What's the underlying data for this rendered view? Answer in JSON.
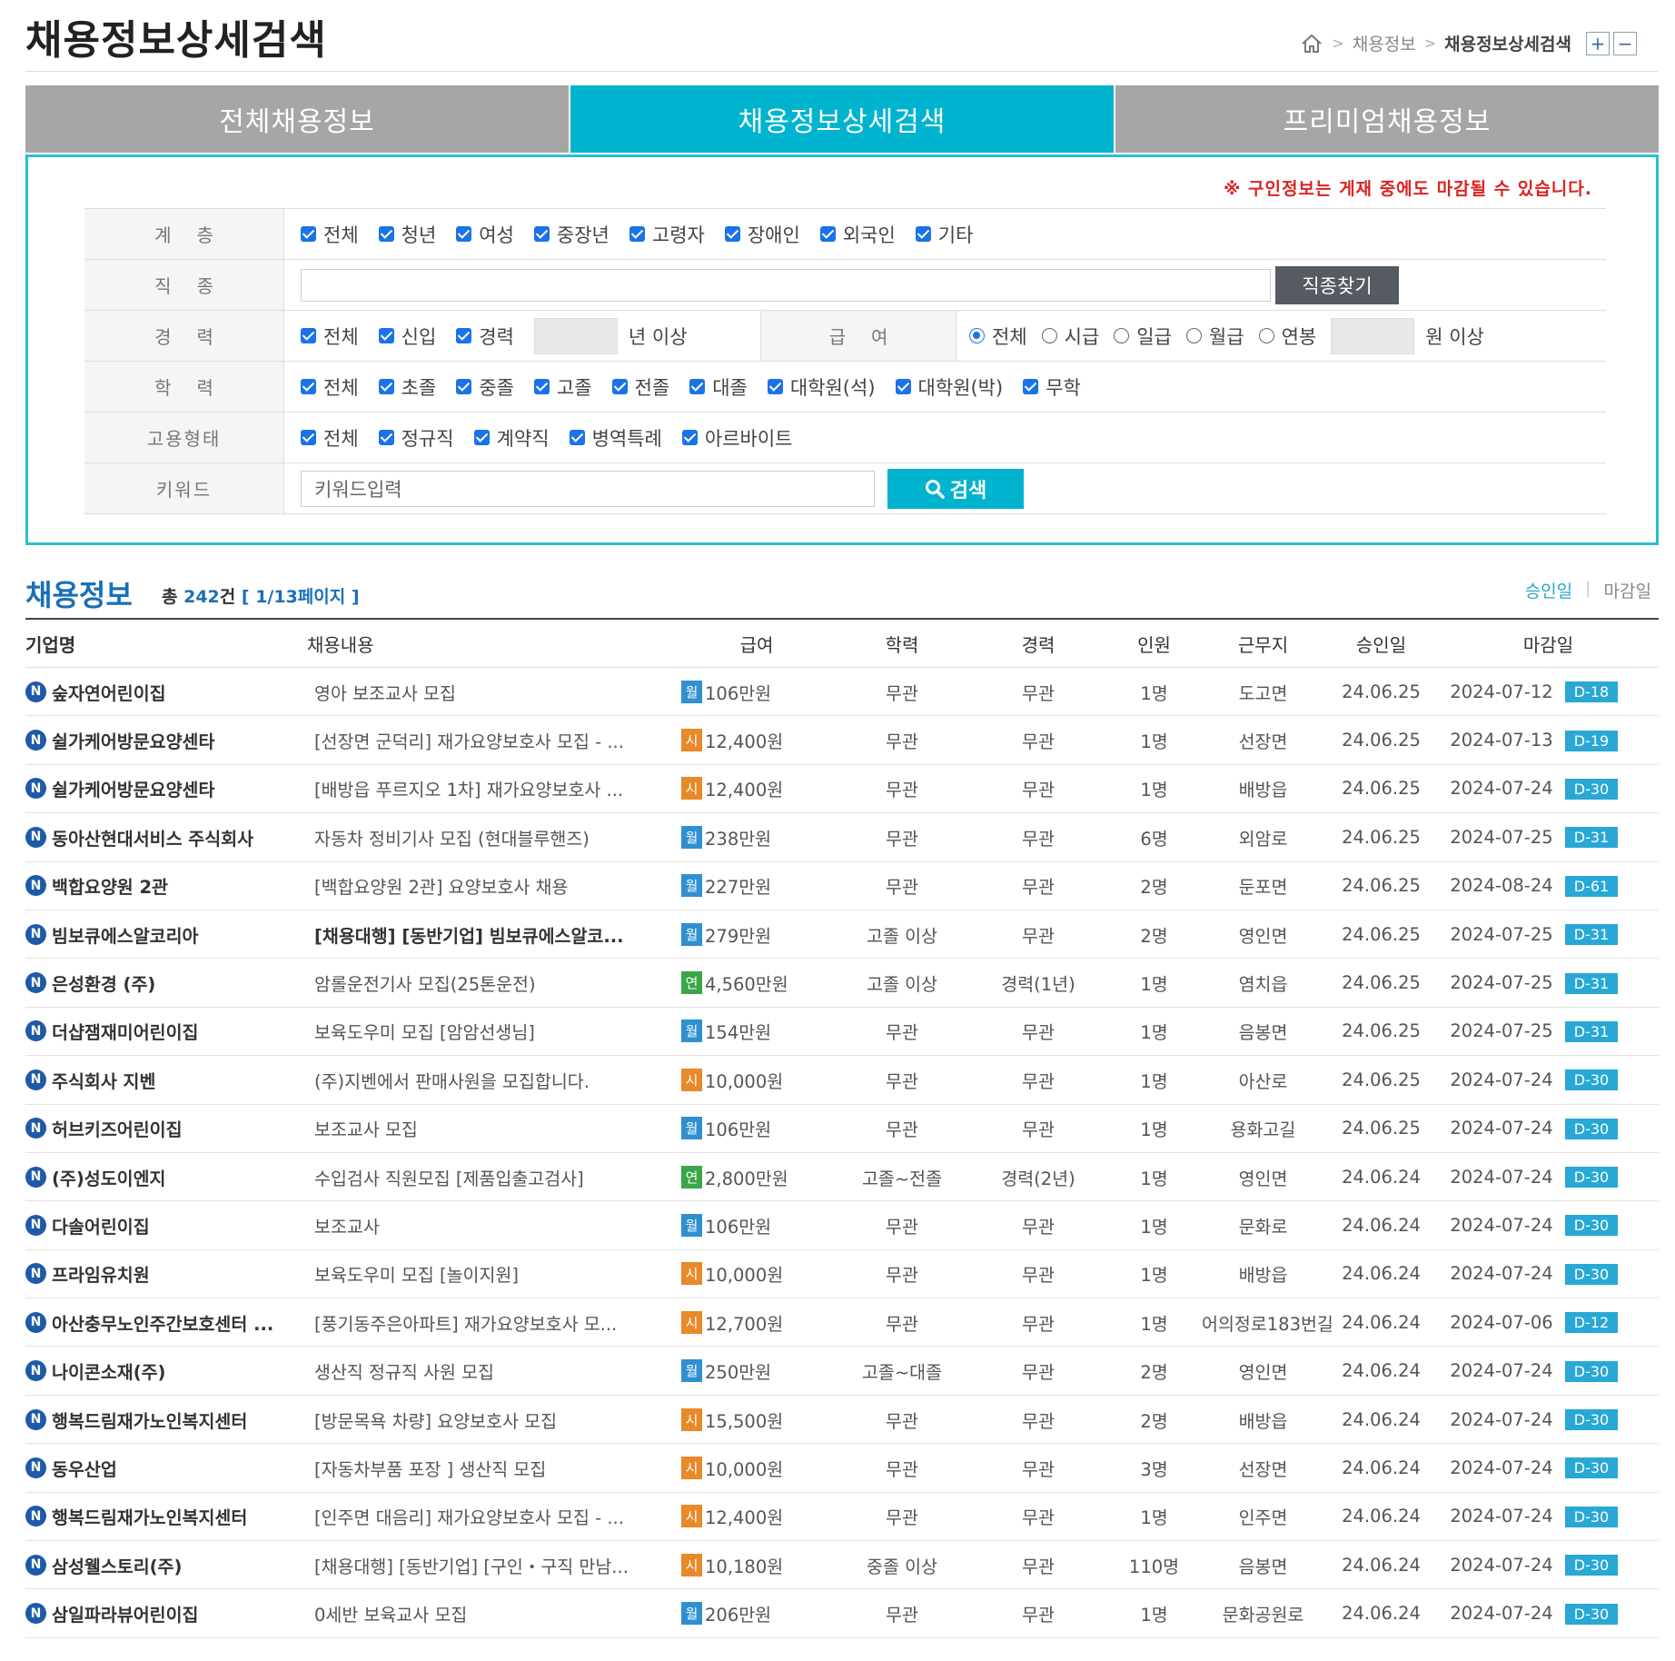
{
  "header": {
    "title": "채용정보상세검색",
    "breadcrumb": [
      "채용정보",
      "채용정보상세검색"
    ],
    "zoom_in": "+",
    "zoom_out": "−"
  },
  "tabs": [
    {
      "label": "전체채용정보",
      "active": false
    },
    {
      "label": "채용정보상세검색",
      "active": true
    },
    {
      "label": "프리미엄채용정보",
      "active": false
    }
  ],
  "search": {
    "notice": "※ 구인정보는 게재 중에도 마감될 수 있습니다.",
    "tier": {
      "label": "계층",
      "options": [
        "전체",
        "청년",
        "여성",
        "중장년",
        "고령자",
        "장애인",
        "외국인",
        "기타"
      ]
    },
    "job": {
      "label": "직종",
      "value": "",
      "button": "직종찾기"
    },
    "career": {
      "label": "경력",
      "options": [
        "전체",
        "신입",
        "경력"
      ],
      "years_suffix": "년 이상"
    },
    "salary": {
      "label": "급여",
      "options": [
        "전체",
        "시급",
        "일급",
        "월급",
        "연봉"
      ],
      "selected": "전체",
      "suffix": "원 이상"
    },
    "education": {
      "label": "학력",
      "options": [
        "전체",
        "초졸",
        "중졸",
        "고졸",
        "전졸",
        "대졸",
        "대학원(석)",
        "대학원(박)",
        "무학"
      ]
    },
    "employment": {
      "label": "고용형태",
      "options": [
        "전체",
        "정규직",
        "계약직",
        "병역특례",
        "아르바이트"
      ]
    },
    "keyword": {
      "label": "키워드",
      "placeholder": "키워드입력",
      "button": "검색"
    }
  },
  "results": {
    "title": "채용정보",
    "total_prefix": "총",
    "total": "242",
    "total_suffix": "건",
    "page_info": "[ 1/13페이지 ]",
    "sort": [
      "승인일",
      "마감일"
    ],
    "columns": [
      "기업명",
      "채용내용",
      "급여",
      "학력",
      "경력",
      "인원",
      "근무지",
      "승인일",
      "마감일"
    ]
  },
  "colors": {
    "accent": "#00b4cf",
    "monthly": "#2f8fd1",
    "hourly": "#e8892a",
    "annual": "#3aa64a",
    "dday": "#29a8d6"
  },
  "jobs": [
    {
      "company": "숲자연어린이집",
      "content": "영아 보조교사 모집",
      "pay_type": "월",
      "pay_color": "#2f8fd1",
      "pay": "106만원",
      "edu": "무관",
      "exp": "무관",
      "count": "1명",
      "loc": "도고면",
      "reg": "24.06.25",
      "deadline": "2024-07-12",
      "dday": "D-18"
    },
    {
      "company": "쉴가케어방문요양센타",
      "content": "[선장면 군덕리] 재가요양보호사 모집 - ...",
      "pay_type": "시",
      "pay_color": "#e8892a",
      "pay": "12,400원",
      "edu": "무관",
      "exp": "무관",
      "count": "1명",
      "loc": "선장면",
      "reg": "24.06.25",
      "deadline": "2024-07-13",
      "dday": "D-19"
    },
    {
      "company": "쉴가케어방문요양센타",
      "content": "[배방읍 푸르지오 1차] 재가요양보호사 ...",
      "pay_type": "시",
      "pay_color": "#e8892a",
      "pay": "12,400원",
      "edu": "무관",
      "exp": "무관",
      "count": "1명",
      "loc": "배방읍",
      "reg": "24.06.25",
      "deadline": "2024-07-24",
      "dday": "D-30"
    },
    {
      "company": "동아산현대서비스 주식회사",
      "content": "자동차 정비기사 모집 (현대블루핸즈)",
      "pay_type": "월",
      "pay_color": "#2f8fd1",
      "pay": "238만원",
      "edu": "무관",
      "exp": "무관",
      "count": "6명",
      "loc": "외암로",
      "reg": "24.06.25",
      "deadline": "2024-07-25",
      "dday": "D-31"
    },
    {
      "company": "백합요양원 2관",
      "content": "[백합요양원 2관] 요양보호사 채용",
      "pay_type": "월",
      "pay_color": "#2f8fd1",
      "pay": "227만원",
      "edu": "무관",
      "exp": "무관",
      "count": "2명",
      "loc": "둔포면",
      "reg": "24.06.25",
      "deadline": "2024-08-24",
      "dday": "D-61"
    },
    {
      "company": "빔보큐에스알코리아",
      "content": "[채용대행] [동반기업] 빔보큐에스알코...",
      "bold": true,
      "pay_type": "월",
      "pay_color": "#2f8fd1",
      "pay": "279만원",
      "edu": "고졸 이상",
      "exp": "무관",
      "count": "2명",
      "loc": "영인면",
      "reg": "24.06.25",
      "deadline": "2024-07-25",
      "dday": "D-31"
    },
    {
      "company": "은성환경 (주)",
      "content": "암롤운전기사 모집(25톤운전)",
      "pay_type": "연",
      "pay_color": "#3aa64a",
      "pay": "4,560만원",
      "edu": "고졸 이상",
      "exp": "경력(1년)",
      "count": "1명",
      "loc": "염치읍",
      "reg": "24.06.25",
      "deadline": "2024-07-25",
      "dday": "D-31"
    },
    {
      "company": "더샵잼재미어린이집",
      "content": "보육도우미 모집 [암암선생님]",
      "pay_type": "월",
      "pay_color": "#2f8fd1",
      "pay": "154만원",
      "edu": "무관",
      "exp": "무관",
      "count": "1명",
      "loc": "음봉면",
      "reg": "24.06.25",
      "deadline": "2024-07-25",
      "dday": "D-31"
    },
    {
      "company": "주식회사 지벤",
      "content": "(주)지벤에서 판매사원을 모집합니다.",
      "pay_type": "시",
      "pay_color": "#e8892a",
      "pay": "10,000원",
      "edu": "무관",
      "exp": "무관",
      "count": "1명",
      "loc": "아산로",
      "reg": "24.06.25",
      "deadline": "2024-07-24",
      "dday": "D-30"
    },
    {
      "company": "허브키즈어린이집",
      "content": "보조교사 모집",
      "pay_type": "월",
      "pay_color": "#2f8fd1",
      "pay": "106만원",
      "edu": "무관",
      "exp": "무관",
      "count": "1명",
      "loc": "용화고길",
      "reg": "24.06.25",
      "deadline": "2024-07-24",
      "dday": "D-30"
    },
    {
      "company": "(주)성도이엔지",
      "content": "수입검사 직원모집 [제품입출고검사]",
      "pay_type": "연",
      "pay_color": "#3aa64a",
      "pay": "2,800만원",
      "edu": "고졸~전졸",
      "exp": "경력(2년)",
      "count": "1명",
      "loc": "영인면",
      "reg": "24.06.24",
      "deadline": "2024-07-24",
      "dday": "D-30"
    },
    {
      "company": "다솔어린이집",
      "content": "보조교사",
      "pay_type": "월",
      "pay_color": "#2f8fd1",
      "pay": "106만원",
      "edu": "무관",
      "exp": "무관",
      "count": "1명",
      "loc": "문화로",
      "reg": "24.06.24",
      "deadline": "2024-07-24",
      "dday": "D-30"
    },
    {
      "company": "프라임유치원",
      "content": "보육도우미 모집 [놀이지원]",
      "pay_type": "시",
      "pay_color": "#e8892a",
      "pay": "10,000원",
      "edu": "무관",
      "exp": "무관",
      "count": "1명",
      "loc": "배방읍",
      "reg": "24.06.24",
      "deadline": "2024-07-24",
      "dday": "D-30"
    },
    {
      "company": "아산충무노인주간보호센터 ...",
      "content": "[풍기동주은아파트] 재가요양보호사 모...",
      "pay_type": "시",
      "pay_color": "#e8892a",
      "pay": "12,700원",
      "edu": "무관",
      "exp": "무관",
      "count": "1명",
      "loc": "어의정로183번길",
      "reg": "24.06.24",
      "deadline": "2024-07-06",
      "dday": "D-12"
    },
    {
      "company": "나이콘소재(주)",
      "content": "생산직 정규직 사원 모집",
      "pay_type": "월",
      "pay_color": "#2f8fd1",
      "pay": "250만원",
      "edu": "고졸~대졸",
      "exp": "무관",
      "count": "2명",
      "loc": "영인면",
      "reg": "24.06.24",
      "deadline": "2024-07-24",
      "dday": "D-30"
    },
    {
      "company": "행복드림재가노인복지센터",
      "content": "[방문목욕 차량] 요양보호사 모집",
      "pay_type": "시",
      "pay_color": "#e8892a",
      "pay": "15,500원",
      "edu": "무관",
      "exp": "무관",
      "count": "2명",
      "loc": "배방읍",
      "reg": "24.06.24",
      "deadline": "2024-07-24",
      "dday": "D-30"
    },
    {
      "company": "동우산업",
      "content": "[자동차부품 포장 ]  생산직 모집",
      "pay_type": "시",
      "pay_color": "#e8892a",
      "pay": "10,000원",
      "edu": "무관",
      "exp": "무관",
      "count": "3명",
      "loc": "선장면",
      "reg": "24.06.24",
      "deadline": "2024-07-24",
      "dday": "D-30"
    },
    {
      "company": "행복드림재가노인복지센터",
      "content": "[인주면 대음리] 재가요양보호사 모집 - ...",
      "pay_type": "시",
      "pay_color": "#e8892a",
      "pay": "12,400원",
      "edu": "무관",
      "exp": "무관",
      "count": "1명",
      "loc": "인주면",
      "reg": "24.06.24",
      "deadline": "2024-07-24",
      "dday": "D-30"
    },
    {
      "company": "삼성웰스토리(주)",
      "content": "[채용대행] [동반기업] [구인・구직 만남...",
      "pay_type": "시",
      "pay_color": "#e8892a",
      "pay": "10,180원",
      "edu": "중졸 이상",
      "exp": "무관",
      "count": "110명",
      "loc": "음봉면",
      "reg": "24.06.24",
      "deadline": "2024-07-24",
      "dday": "D-30"
    },
    {
      "company": "삼일파라뷰어린이집",
      "content": "0세반 보육교사 모집",
      "pay_type": "월",
      "pay_color": "#2f8fd1",
      "pay": "206만원",
      "edu": "무관",
      "exp": "무관",
      "count": "1명",
      "loc": "문화공원로",
      "reg": "24.06.24",
      "deadline": "2024-07-24",
      "dday": "D-30"
    }
  ]
}
